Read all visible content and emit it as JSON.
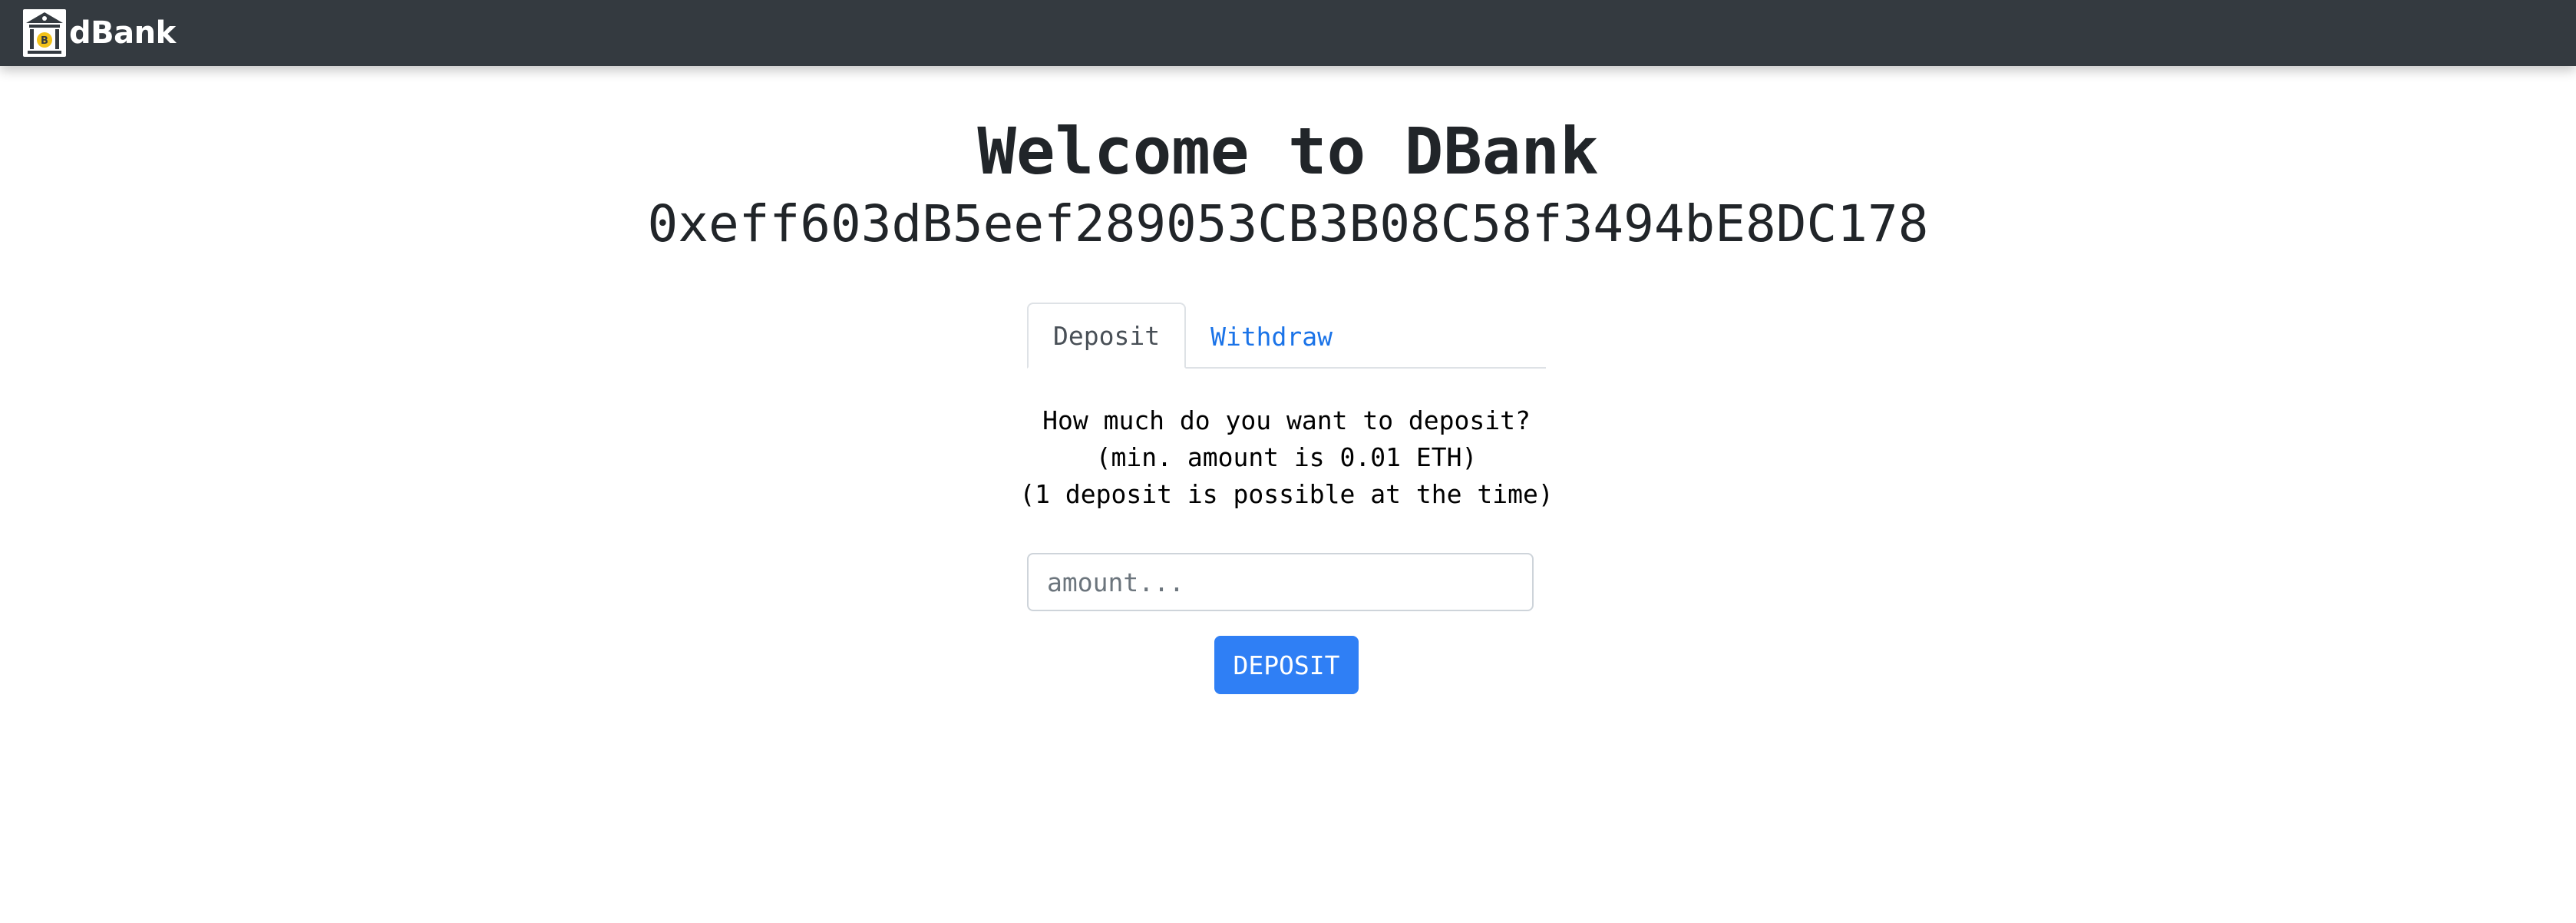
{
  "navbar": {
    "brand_text": "dBank",
    "logo_icon": "bank-building-bitcoin-icon",
    "background": "#343a40"
  },
  "main": {
    "title": "Welcome to DBank",
    "address": "0xeff603dB5eef289053CB3B08C58f3494bE8DC178"
  },
  "tabs": [
    {
      "label": "Deposit",
      "active": true
    },
    {
      "label": "Withdraw",
      "active": false
    }
  ],
  "deposit": {
    "prompt_line1": "How much do you want to deposit?",
    "prompt_line2": "(min. amount is 0.01 ETH)",
    "prompt_line3": "(1 deposit is possible at the time)",
    "amount_value": "",
    "amount_placeholder": "amount...",
    "button_label": "DEPOSIT"
  },
  "colors": {
    "accent": "#2f7ff5",
    "link": "#1a73e8",
    "text": "#212529"
  }
}
